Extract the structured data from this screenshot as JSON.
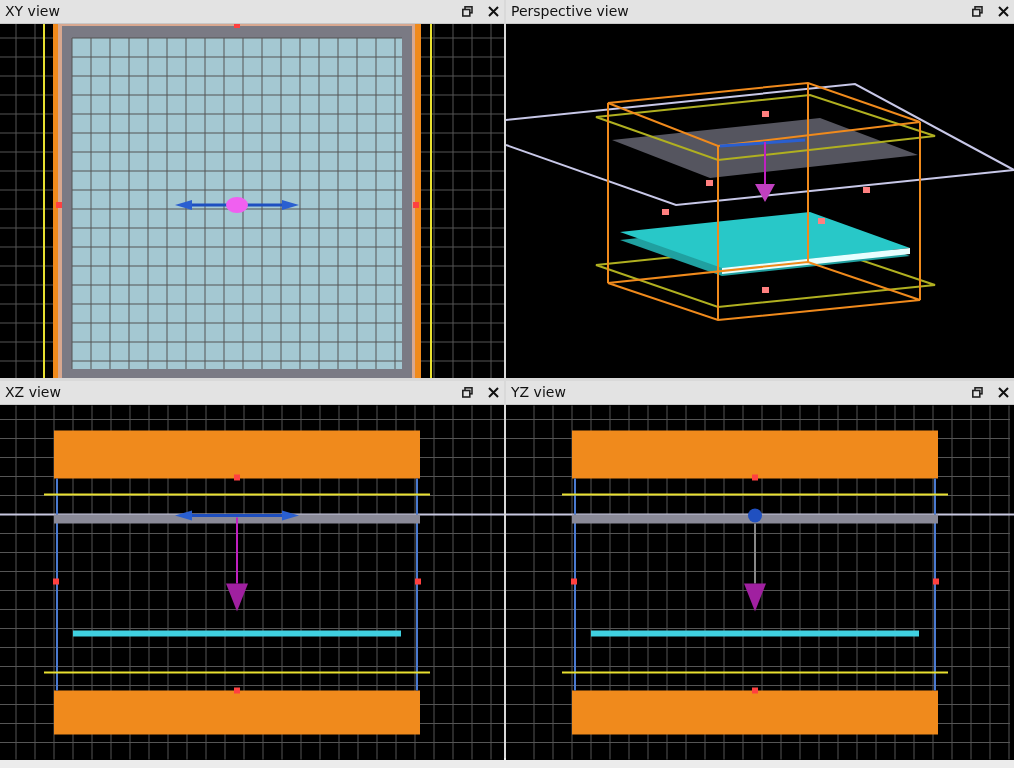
{
  "views": [
    {
      "title": "XY view",
      "kind": "xy"
    },
    {
      "title": "Perspective view",
      "kind": "perspective"
    },
    {
      "title": "XZ view",
      "kind": "xz"
    },
    {
      "title": "YZ view",
      "kind": "yz"
    }
  ]
}
